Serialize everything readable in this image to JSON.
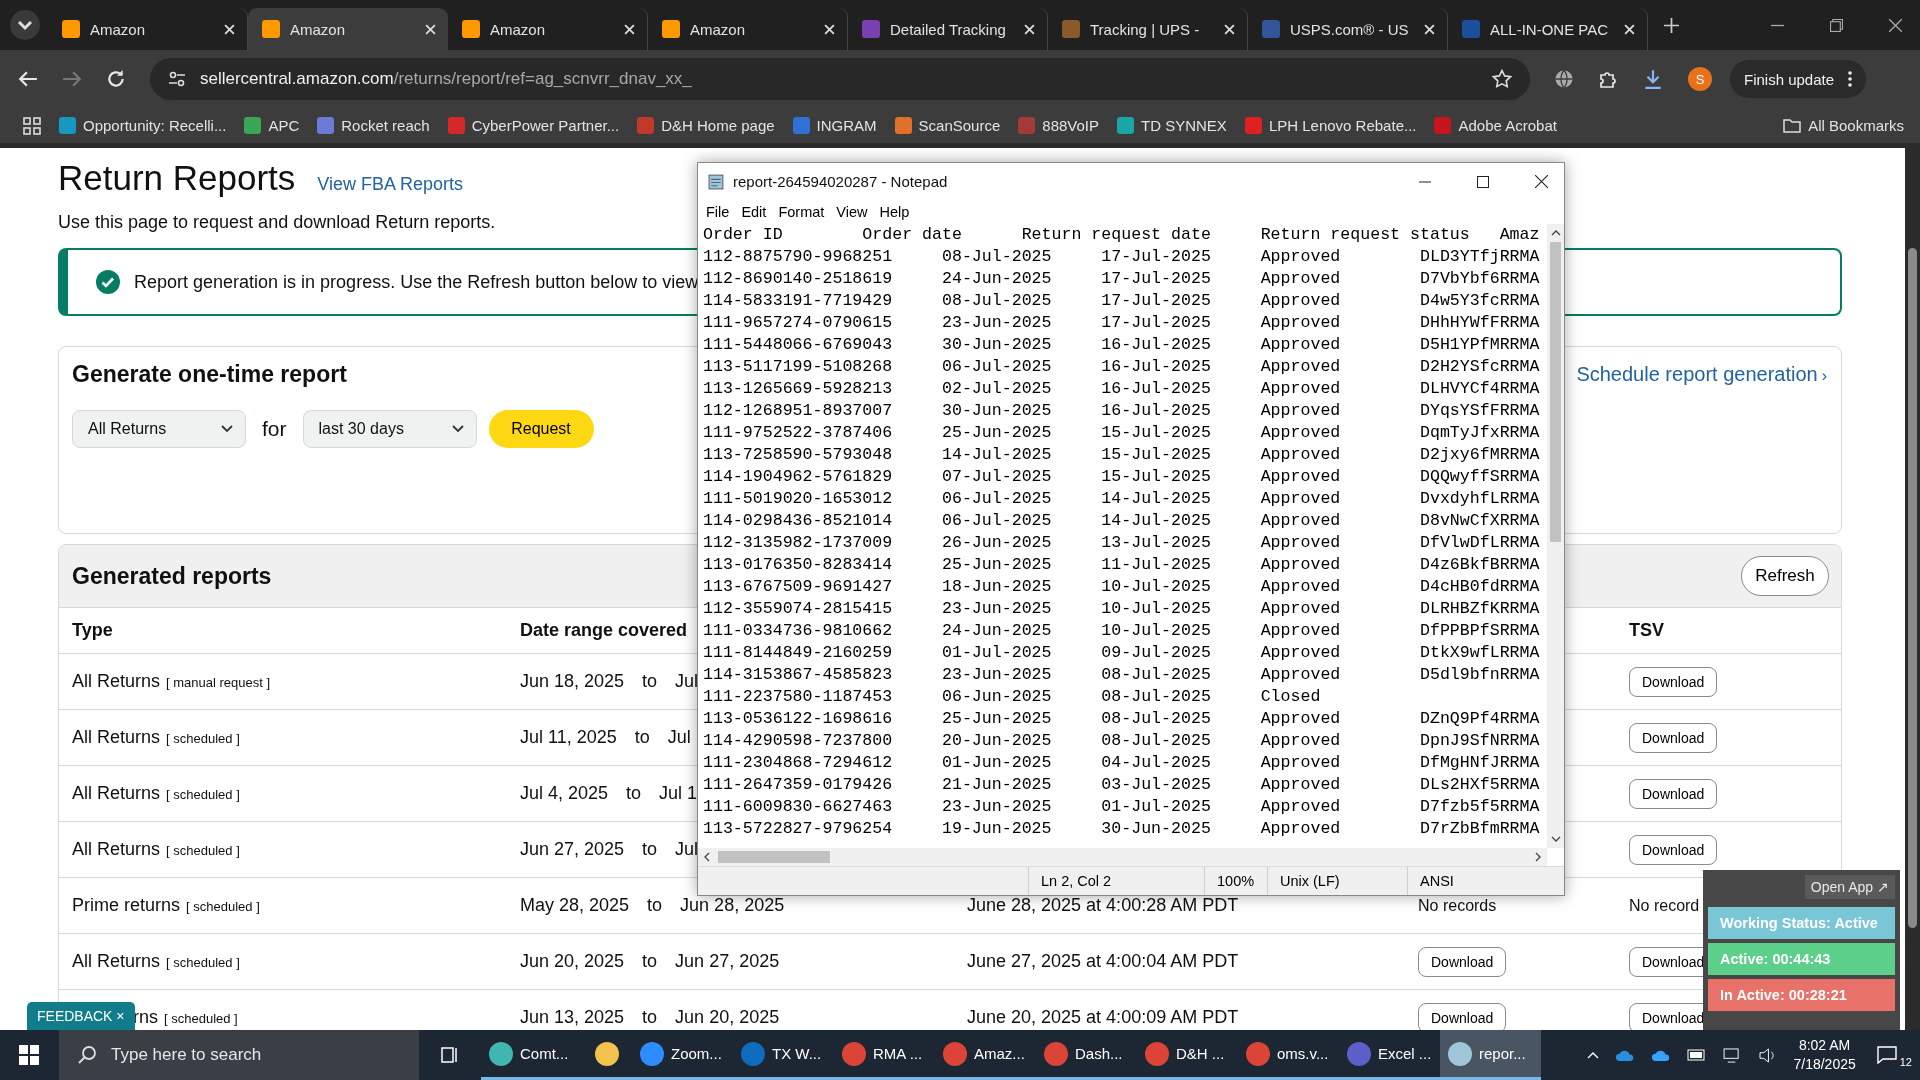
{
  "browser": {
    "tabs": [
      {
        "title": "Amazon",
        "selected": false,
        "color": "#ff9900"
      },
      {
        "title": "Amazon",
        "selected": true,
        "color": "#ff9900"
      },
      {
        "title": "Amazon",
        "selected": false,
        "color": "#ff9900"
      },
      {
        "title": "Amazon",
        "selected": false,
        "color": "#ff9900"
      },
      {
        "title": "Detailed Tracking",
        "selected": false,
        "color": "#7a3fb0"
      },
      {
        "title": "Tracking | UPS -",
        "selected": false,
        "color": "#8a5a2b"
      },
      {
        "title": "USPS.com® - US",
        "selected": false,
        "color": "#335599"
      },
      {
        "title": "ALL-IN-ONE PAC",
        "selected": false,
        "color": "#1a4f9c"
      }
    ],
    "url": {
      "host": "sellercentral.amazon.com",
      "path": "/returns/report/ref=ag_scnvrr_dnav_xx_"
    },
    "avatar_letter": "S",
    "update_button": "Finish update",
    "bookmarks": [
      {
        "label": "Opportunity: Recelli...",
        "color": "#1798c1"
      },
      {
        "label": "APC",
        "color": "#3aa655"
      },
      {
        "label": "Rocket reach",
        "color": "#6b7bd6"
      },
      {
        "label": "CyberPower Partner...",
        "color": "#d62828"
      },
      {
        "label": "D&H Home page",
        "color": "#c0392b"
      },
      {
        "label": "INGRAM",
        "color": "#2f6fd6"
      },
      {
        "label": "ScanSource",
        "color": "#e0702a"
      },
      {
        "label": "888VoIP",
        "color": "#a33a3a"
      },
      {
        "label": "TD SYNNEX",
        "color": "#1aa6a6"
      },
      {
        "label": "LPH Lenovo Rebate...",
        "color": "#e02020"
      },
      {
        "label": "Adobe Acrobat",
        "color": "#c4161c"
      }
    ],
    "all_bookmarks": "All Bookmarks"
  },
  "page": {
    "title": "Return Reports",
    "fba_link": "View FBA Reports",
    "intro": "Use this page to request and download Return reports.",
    "banner": "Report generation is in progress. Use the Refresh button below to view",
    "generate": {
      "title": "Generate one-time report",
      "type_select": "All Returns",
      "for": "for",
      "range_select": "last 30 days",
      "request": "Request",
      "schedule_link": "Schedule report generation",
      "schedule_chevron": "›"
    },
    "generated": {
      "title": "Generated reports",
      "refresh": "Refresh",
      "columns": {
        "type": "Type",
        "range": "Date range covered",
        "tsv": "TSV"
      },
      "rows": [
        {
          "type": "All Returns",
          "note": "[ manual request ]",
          "from": "Jun 18, 2025",
          "to": "to",
          "until": "Jul",
          "tsv": {
            "kind": "button",
            "text": "Download"
          }
        },
        {
          "type": "All Returns",
          "note": "[ scheduled ]",
          "from": "Jul 11, 2025",
          "to": "to",
          "until": "Jul",
          "tsv": {
            "kind": "button",
            "text": "Download"
          }
        },
        {
          "type": "All Returns",
          "note": "[ scheduled ]",
          "from": "Jul 4, 2025",
          "to": "to",
          "until": "Jul 1",
          "tsv": {
            "kind": "button",
            "text": "Download"
          }
        },
        {
          "type": "All Returns",
          "note": "[ scheduled ]",
          "from": "Jun 27, 2025",
          "to": "to",
          "until": "Jul",
          "tsv": {
            "kind": "button",
            "text": "Download"
          }
        },
        {
          "type": "Prime returns",
          "note": "[ scheduled ]",
          "from": "May 28, 2025",
          "to": "to",
          "until": "Jun 28, 2025",
          "generated": "June 28, 2025 at 4:00:28 AM PDT",
          "column_4": {
            "kind": "text",
            "text": "No records"
          },
          "tsv": {
            "kind": "text",
            "text": "No record"
          }
        },
        {
          "type": "All Returns",
          "note": "[ scheduled ]",
          "from": "Jun 20, 2025",
          "to": "to",
          "until": "Jun 27, 2025",
          "generated": "June 27, 2025 at 4:00:04 AM PDT",
          "column_4": {
            "kind": "button",
            "text": "Download"
          },
          "tsv": {
            "kind": "button",
            "text": "Download"
          }
        },
        {
          "type": "rns",
          "note": "[ scheduled ]",
          "from": "Jun 13, 2025",
          "to": "to",
          "until": "Jun 20, 2025",
          "generated": "June 20, 2025 at 4:00:09 AM PDT",
          "column_4": {
            "kind": "button",
            "text": "Download"
          },
          "tsv": {
            "kind": "button",
            "text": "Download"
          }
        }
      ]
    }
  },
  "feedback": {
    "label": "FEEDBACK",
    "close": "×"
  },
  "notepad": {
    "title": "report-264594020287 - Notepad",
    "menu": [
      "File",
      "Edit",
      "Format",
      "View",
      "Help"
    ],
    "lines": [
      "Order ID\tOrder date\tReturn request date\tReturn request status\tAmaz",
      "112-8875790-9968251\t08-Jul-2025\t17-Jul-2025\tApproved\tDLD3YTfjRRMA",
      "112-8690140-2518619\t24-Jun-2025\t17-Jul-2025\tApproved\tD7VbYbf6RRMA",
      "114-5833191-7719429\t08-Jul-2025\t17-Jul-2025\tApproved\tD4w5Y3fcRRMA",
      "111-9657274-0790615\t23-Jun-2025\t17-Jul-2025\tApproved\tDHhHYWfFRRMA",
      "111-5448066-6769043\t30-Jun-2025\t16-Jul-2025\tApproved\tD5H1YPfMRRMA",
      "113-5117199-5108268\t06-Jul-2025\t16-Jul-2025\tApproved\tD2H2YSfcRRMA",
      "113-1265669-5928213\t02-Jul-2025\t16-Jul-2025\tApproved\tDLHVYCf4RRMA",
      "112-1268951-8937007\t30-Jun-2025\t16-Jul-2025\tApproved\tDYqsYSfFRRMA",
      "111-9752522-3787406\t25-Jun-2025\t15-Jul-2025\tApproved\tDqmTyJfxRRMA",
      "113-7258590-5793048\t14-Jul-2025\t15-Jul-2025\tApproved\tD2jxy6fMRRMA",
      "114-1904962-5761829\t07-Jul-2025\t15-Jul-2025\tApproved\tDQQwyffSRRMA",
      "111-5019020-1653012\t06-Jul-2025\t14-Jul-2025\tApproved\tDvxdyhfLRRMA",
      "114-0298436-8521014\t06-Jul-2025\t14-Jul-2025\tApproved\tD8vNwCfXRRMA",
      "112-3135982-1737009\t26-Jun-2025\t13-Jul-2025\tApproved\tDfVlwDfLRRMA",
      "113-0176350-8283414\t25-Jun-2025\t11-Jul-2025\tApproved\tD4z6BkfBRRMA",
      "113-6767509-9691427\t18-Jun-2025\t10-Jul-2025\tApproved\tD4cHB0fdRRMA",
      "112-3559074-2815415\t23-Jun-2025\t10-Jul-2025\tApproved\tDLRHBZfKRRMA",
      "111-0334736-9810662\t24-Jun-2025\t10-Jul-2025\tApproved\tDfPPBPfSRRMA",
      "111-8144849-2160259\t01-Jul-2025\t09-Jul-2025\tApproved\tDtkX9wfLRRMA",
      "114-3153867-4585823\t23-Jun-2025\t08-Jul-2025\tApproved\tD5dl9bfnRRMA",
      "111-2237580-1187453\t06-Jun-2025\t08-Jul-2025\tClosed",
      "113-0536122-1698616\t25-Jun-2025\t08-Jul-2025\tApproved\tDZnQ9Pf4RRMA",
      "114-4290598-7237800\t20-Jun-2025\t08-Jul-2025\tApproved\tDpnJ9SfNRRMA",
      "111-2304868-7294612\t01-Jun-2025\t04-Jul-2025\tApproved\tDfMgHNfJRRMA",
      "111-2647359-0179426\t21-Jun-2025\t03-Jul-2025\tApproved\tDLs2HXf5RRMA",
      "111-6009830-6627463\t23-Jun-2025\t01-Jul-2025\tApproved\tD7fzb5f5RRMA",
      "113-5722827-9796254\t19-Jun-2025\t30-Jun-2025\tApproved\tD7rZbBfmRRMA"
    ],
    "status": [
      "Ln 2, Col 2",
      "100%",
      "Unix (LF)",
      "ANSI"
    ]
  },
  "tracker_widget": {
    "open_app": "Open App ↗",
    "items": [
      {
        "label": "Working Status: Active",
        "color": "#78c6d6"
      },
      {
        "label": "Active: 00:44:43",
        "color": "#5ccf8a"
      },
      {
        "label": "In Active: 00:28:21",
        "color": "#e8726a"
      }
    ]
  },
  "taskbar": {
    "search_placeholder": "Type here to search",
    "apps": [
      {
        "label": "Comt...",
        "color": "#3fb6b0",
        "selected": false
      },
      {
        "color": "#f2c14e",
        "selected": false
      },
      {
        "label": "Zoom...",
        "color": "#2d8cff",
        "selected": false
      },
      {
        "label": "TX W...",
        "color": "#0f6cbd",
        "selected": false
      },
      {
        "label": "RMA ...",
        "color": "#db4437",
        "selected": false
      },
      {
        "label": "Amaz...",
        "color": "#db4437",
        "selected": false
      },
      {
        "label": "Dash...",
        "color": "#db4437",
        "selected": false
      },
      {
        "label": "D&H ...",
        "color": "#db4437",
        "selected": false
      },
      {
        "label": "oms.v...",
        "color": "#db4437",
        "selected": false
      },
      {
        "label": "Excel ...",
        "color": "#5b5fc7",
        "selected": false
      },
      {
        "label": "repor...",
        "color": "#9fc6d8",
        "selected": true
      }
    ],
    "time": "8:02 AM",
    "date": "7/18/2025",
    "notifications": "12"
  }
}
